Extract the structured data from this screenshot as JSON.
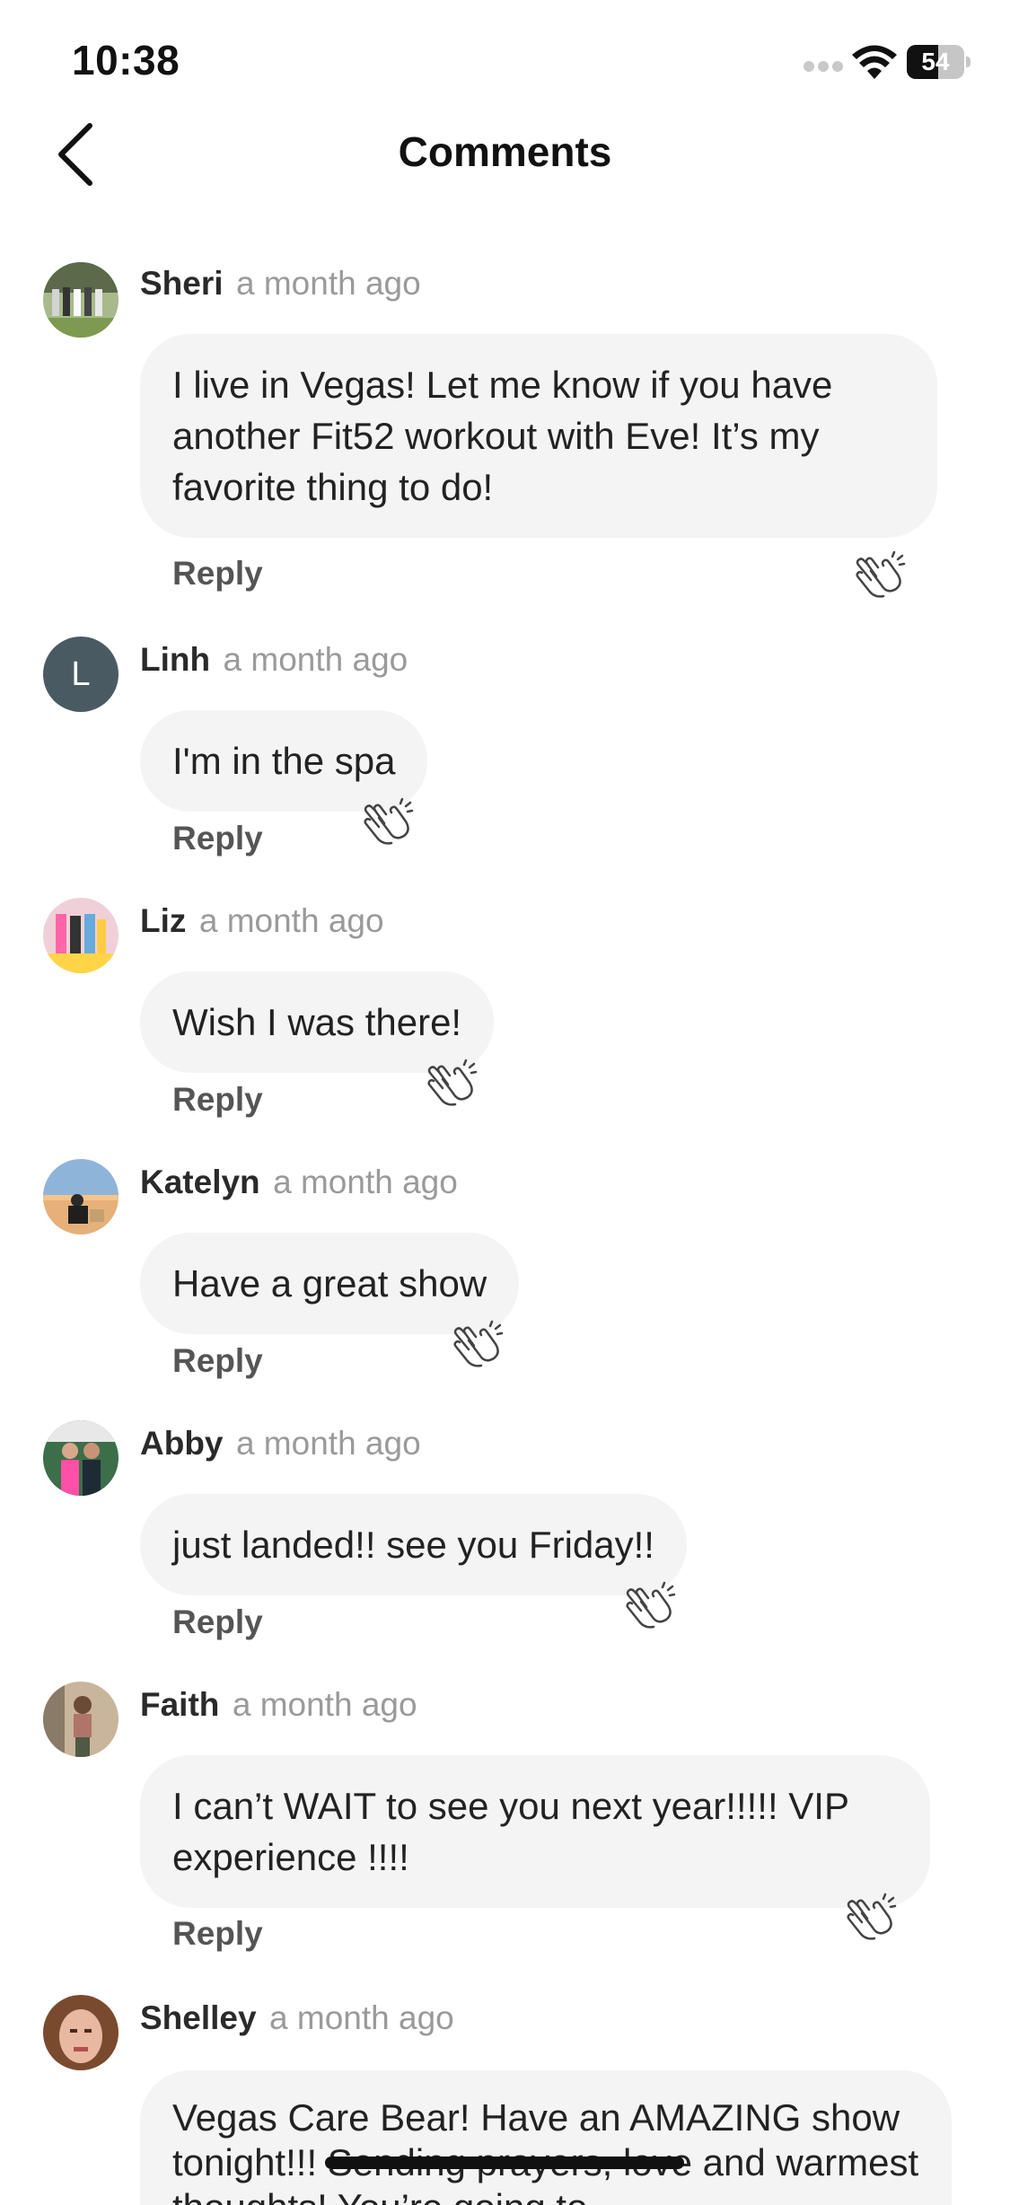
{
  "status_bar": {
    "time": "10:38",
    "battery": "54"
  },
  "nav": {
    "title": "Comments",
    "back_icon": "chevron-left-icon"
  },
  "comments": [
    {
      "author": "Sheri",
      "time": "a month ago",
      "text": "I live in Vegas!  Let me know if you have another Fit52 workout with Eve!  It’s my favorite thing to do!",
      "reply_label": "Reply",
      "avatar_initial": ""
    },
    {
      "author": "Linh",
      "time": "a month ago",
      "text": "I'm in the spa",
      "reply_label": "Reply",
      "avatar_initial": "L"
    },
    {
      "author": "Liz",
      "time": "a month ago",
      "text": "Wish I was there!",
      "reply_label": "Reply",
      "avatar_initial": ""
    },
    {
      "author": "Katelyn",
      "time": "a month ago",
      "text": "Have a great show",
      "reply_label": "Reply",
      "avatar_initial": ""
    },
    {
      "author": "Abby",
      "time": "a month ago",
      "text": "just landed!! see you Friday!!",
      "reply_label": "Reply",
      "avatar_initial": ""
    },
    {
      "author": "Faith",
      "time": "a month ago",
      "text": "I can’t WAIT to see you next year!!!!! VIP experience !!!!",
      "reply_label": "Reply",
      "avatar_initial": ""
    },
    {
      "author": "Shelley",
      "time": "a month ago",
      "text": "Vegas Care Bear! Have an AMAZING show tonight!!! Sending prayers, love and warmest thoughts! You’re going to",
      "reply_label": "",
      "avatar_initial": ""
    }
  ],
  "colors": {
    "bubble": "#f4f4f4",
    "author": "#2a2a2a",
    "time": "#9a9a9a",
    "initial_avatar": "#4a5a63"
  }
}
